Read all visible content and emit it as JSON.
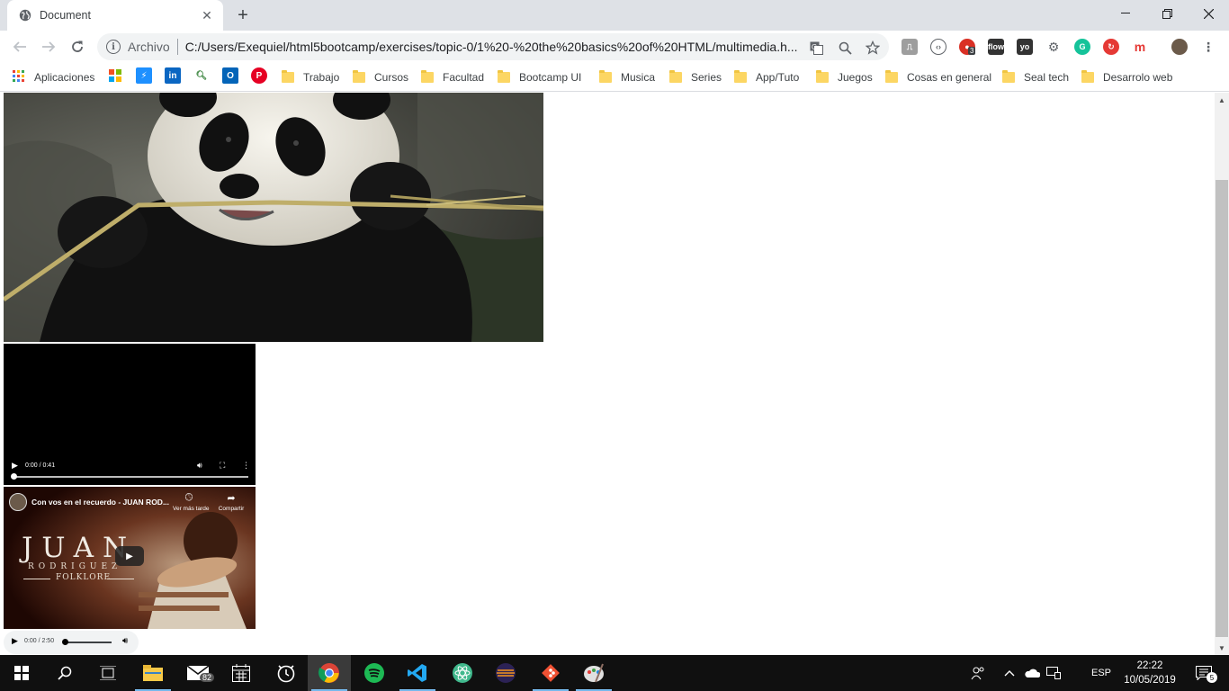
{
  "browser": {
    "tab_title": "Document",
    "new_tab_symbol": "+",
    "address": {
      "scheme_label": "Archivo",
      "url": "C:/Users/Exequiel/html5bootcamp/exercises/topic-0/1%20-%20the%20basics%20of%20HTML/multimedia.h..."
    },
    "extension_badge": "3"
  },
  "bookmarks": {
    "apps_label": "Aplicaciones",
    "folders": [
      "Trabajo",
      "Cursos",
      "Facultad",
      "Bootcamp UI",
      "Musica",
      "Series",
      "App/Tuto",
      "Juegos",
      "Cosas en general",
      "Seal tech",
      "Desarrolo web"
    ]
  },
  "page": {
    "video": {
      "time": "0:00 / 0:41"
    },
    "youtube": {
      "title": "Con vos en el recuerdo - JUAN ROD...",
      "watch_later": "Ver más tarde",
      "share": "Compartir",
      "thumb_name": "JUAN",
      "thumb_sub": "RODRIGUEZ",
      "thumb_sub2": "FOLKLORE"
    },
    "audio": {
      "time": "0:00 / 2:50"
    }
  },
  "taskbar": {
    "mail_badge": "82",
    "language": "ESP",
    "time": "22:22",
    "date": "10/05/2019",
    "notifications_badge": "5"
  },
  "colors": {
    "chrome_tab_strip": "#dee1e6",
    "taskbar": "#101010",
    "accent": "#76b9ed"
  }
}
